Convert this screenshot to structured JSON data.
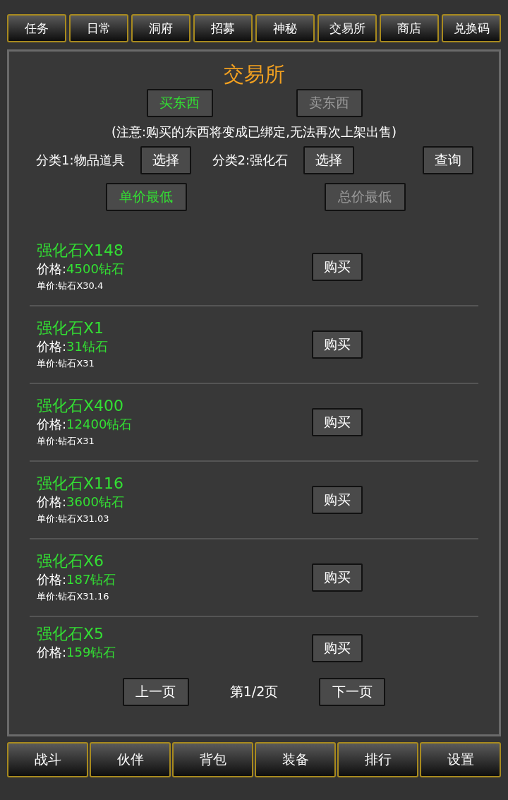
{
  "top_tabs": [
    "任务",
    "日常",
    "洞府",
    "招募",
    "神秘",
    "交易所",
    "商店",
    "兑换码"
  ],
  "title": "交易所",
  "modes": [
    {
      "label": "买东西",
      "selected": true
    },
    {
      "label": "卖东西",
      "selected": false
    }
  ],
  "notice": "(注意:购买的东西将变成已绑定,无法再次上架出售)",
  "filters": [
    {
      "label": "分类1:物品道具",
      "button": "选择"
    },
    {
      "label": "分类2:强化石",
      "button": "选择"
    }
  ],
  "query_button": "查询",
  "sorts": [
    {
      "label": "单价最低",
      "selected": true
    },
    {
      "label": "总价最低",
      "selected": false
    }
  ],
  "listings": [
    {
      "name": "强化石X148",
      "price_label": "价格:",
      "price": "4500钻石",
      "unit": "单价:钻石X30.4",
      "button": "购买"
    },
    {
      "name": "强化石X1",
      "price_label": "价格:",
      "price": "31钻石",
      "unit": "单价:钻石X31",
      "button": "购买"
    },
    {
      "name": "强化石X400",
      "price_label": "价格:",
      "price": "12400钻石",
      "unit": "单价:钻石X31",
      "button": "购买"
    },
    {
      "name": "强化石X116",
      "price_label": "价格:",
      "price": "3600钻石",
      "unit": "单价:钻石X31.03",
      "button": "购买"
    },
    {
      "name": "强化石X6",
      "price_label": "价格:",
      "price": "187钻石",
      "unit": "单价:钻石X31.16",
      "button": "购买"
    },
    {
      "name": "强化石X5",
      "price_label": "价格:",
      "price": "159钻石",
      "button": "购买"
    }
  ],
  "pager": {
    "prev": "上一页",
    "page": "第1/2页",
    "next": "下一页"
  },
  "bottom_nav": [
    "战斗",
    "伙伴",
    "背包",
    "装备",
    "排行",
    "设置"
  ]
}
